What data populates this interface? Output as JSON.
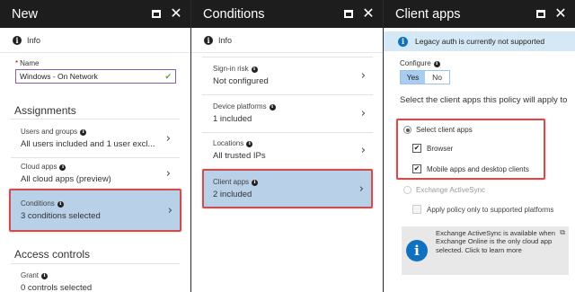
{
  "new_blade": {
    "title": "New",
    "info_label": "Info",
    "name_label": "Name",
    "name_value": "Windows - On Network",
    "assignments_heading": "Assignments",
    "users": {
      "label": "Users and groups",
      "value": "All users included and 1 user excl..."
    },
    "cloud_apps": {
      "label": "Cloud apps",
      "value": "All cloud apps (preview)"
    },
    "conditions": {
      "label": "Conditions",
      "value": "3 conditions selected"
    },
    "access_heading": "Access controls",
    "grant": {
      "label": "Grant",
      "value": "0 controls selected"
    }
  },
  "conditions_blade": {
    "title": "Conditions",
    "info_label": "Info",
    "items": [
      {
        "label": "Sign-in risk",
        "value": "Not configured"
      },
      {
        "label": "Device platforms",
        "value": "1 included"
      },
      {
        "label": "Locations",
        "value": "All trusted IPs"
      },
      {
        "label": "Client apps",
        "value": "2 included"
      }
    ]
  },
  "client_apps_blade": {
    "title": "Client apps",
    "banner": "Legacy auth is currently not supported",
    "configure_label": "Configure",
    "toggle_yes": "Yes",
    "toggle_no": "No",
    "select_heading": "Select the client apps this policy will apply to",
    "select_option": "Select client apps",
    "browser": "Browser",
    "mobile": "Mobile apps and desktop clients",
    "exchange_option": "Exchange ActiveSync",
    "apply_supported": "Apply policy only to supported platforms",
    "exchange_note": "Exchange ActiveSync is available when Exchange Online is the only cloud app selected. Click to learn more"
  },
  "colors": {
    "titlebar": "#1d1d1d",
    "selected_row": "#b8d0e8",
    "highlight_box": "#c9504f",
    "banner": "#d4e8f6",
    "info_blue": "#1071c0"
  },
  "icons": [
    "info-icon",
    "maximize-icon",
    "close-icon",
    "chevron-right-icon",
    "check-icon",
    "external-link-icon"
  ]
}
